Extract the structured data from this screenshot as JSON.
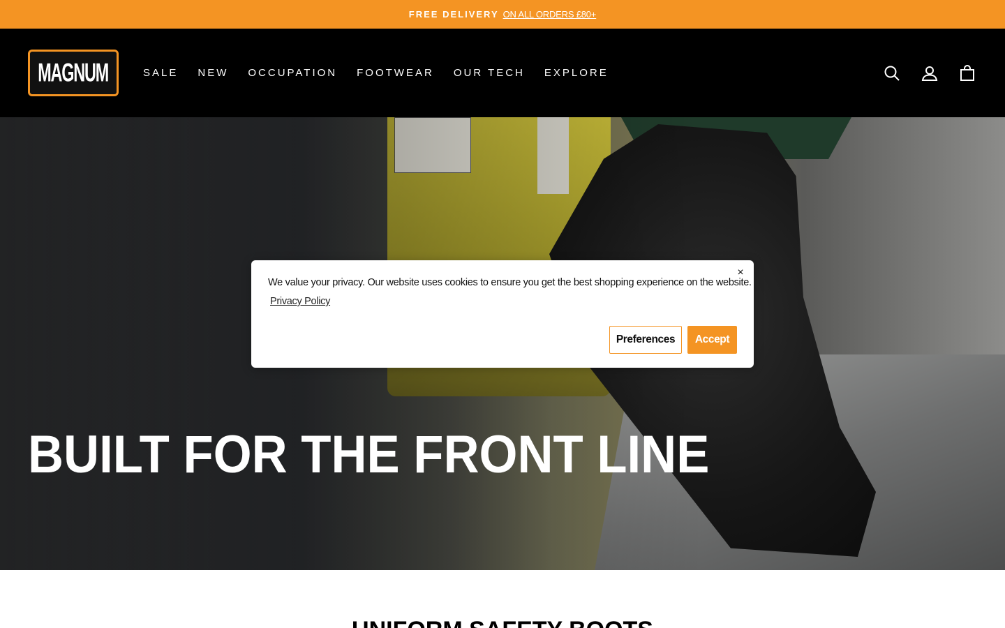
{
  "announcement": {
    "strong_text": "FREE DELIVERY",
    "link_text": "ON ALL ORDERS £80+"
  },
  "header": {
    "logo_text": "MAGNUM",
    "nav": [
      {
        "label": "SALE"
      },
      {
        "label": "NEW"
      },
      {
        "label": "OCCUPATION"
      },
      {
        "label": "FOOTWEAR"
      },
      {
        "label": "OUR TECH"
      },
      {
        "label": "EXPLORE"
      }
    ],
    "icons": [
      "search-icon",
      "account-icon",
      "cart-icon"
    ]
  },
  "hero": {
    "title": "BUILT FOR THE FRONT LINE"
  },
  "cookie": {
    "message": "We value your privacy. Our website uses cookies to ensure you get the best shopping experience on the website.",
    "privacy_link": "Privacy Policy",
    "close_symbol": "×",
    "preferences_label": "Preferences",
    "accept_label": "Accept"
  },
  "section": {
    "heading": "UNIFORM SAFETY BOOTS"
  },
  "colors": {
    "accent": "#f49423",
    "header_bg": "#000000",
    "text_light": "#ffffff"
  }
}
